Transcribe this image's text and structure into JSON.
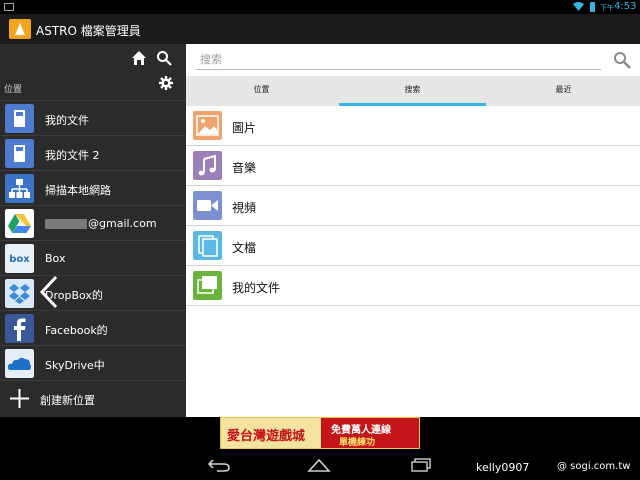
{
  "status_bar": {
    "ampm": "下午",
    "time": "4:53",
    "accent_color": "#33b5e5"
  },
  "app": {
    "title": "ASTRO 檔案管理員",
    "logo_icon": "astro-app-icon"
  },
  "sidebar": {
    "section_label": "位置",
    "top_icons": [
      "home-icon",
      "search-icon",
      "gear-icon"
    ],
    "items": [
      {
        "label": "我的文件",
        "icon": "sdcard-icon"
      },
      {
        "label": "我的文件 2",
        "icon": "sdcard-icon"
      },
      {
        "label": "掃描本地網路",
        "icon": "network-icon"
      },
      {
        "label": "@gmail.com",
        "icon": "google-drive-icon"
      },
      {
        "label": "Box",
        "icon": "box-icon"
      },
      {
        "label": "DropBox的",
        "icon": "dropbox-icon"
      },
      {
        "label": "Facebook的",
        "icon": "facebook-icon"
      },
      {
        "label": "SkyDrive中",
        "icon": "skydrive-icon"
      },
      {
        "label": "創建新位置",
        "icon": "plus-icon"
      }
    ]
  },
  "main": {
    "search": {
      "placeholder": "搜索"
    },
    "tabs": [
      {
        "label": "位置",
        "active": false
      },
      {
        "label": "搜索",
        "active": true
      },
      {
        "label": "最近",
        "active": false
      }
    ],
    "categories": [
      {
        "label": "圖片",
        "icon": "image-icon",
        "color": "#f0a36b"
      },
      {
        "label": "音樂",
        "icon": "music-icon",
        "color": "#9b7fb6"
      },
      {
        "label": "視頻",
        "icon": "video-icon",
        "color": "#7d8fd1"
      },
      {
        "label": "文檔",
        "icon": "document-icon",
        "color": "#5bb8e3"
      },
      {
        "label": "我的文件",
        "icon": "folder-icon",
        "color": "#6bb33d"
      }
    ]
  },
  "ad": {
    "brand": "愛台灣遊戲城",
    "line1": "免費萬人連線",
    "line2": "單機練功"
  },
  "nav_bar": {
    "icons": [
      "back-icon",
      "home-icon",
      "recent-apps-icon"
    ]
  },
  "watermark": {
    "user": "kelly0907",
    "site": "@ sogi.com.tw"
  }
}
